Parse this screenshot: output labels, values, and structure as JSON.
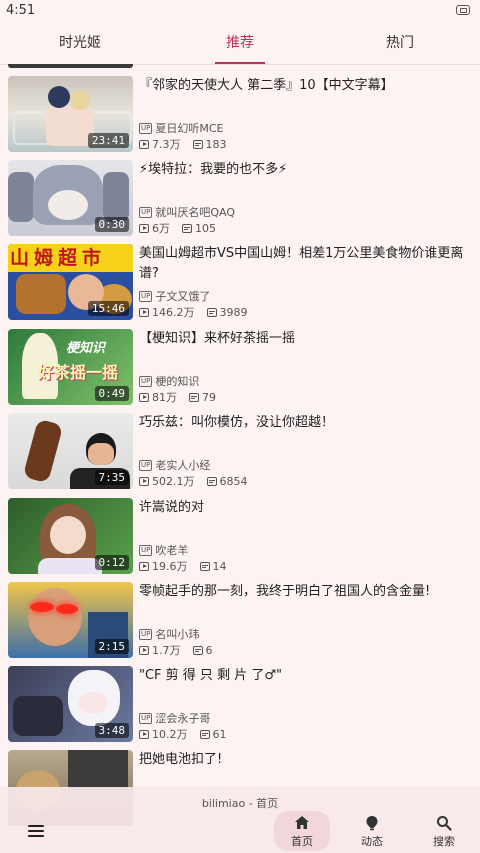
{
  "status_bar": {
    "time": "4:51"
  },
  "tabs": [
    {
      "label": "时光姬"
    },
    {
      "label": "推荐"
    },
    {
      "label": "热门"
    }
  ],
  "active_tab": "推荐",
  "accent_color": "#c0305e",
  "up_badge": "UP",
  "videos": [
    {
      "title": "『邻家的天使大人 第二季』10【中文字幕】",
      "author": "夏日幻听MCE",
      "views": "7.3万",
      "danmaku": "183",
      "duration": "23:41"
    },
    {
      "title": "⚡埃特拉：我要的也不多⚡",
      "author": "就叫厌名吧QAQ",
      "views": "6万",
      "danmaku": "105",
      "duration": "0:30"
    },
    {
      "title": "美国山姆超市VS中国山姆！相差1万公里美食物价谁更离谱?",
      "author": "子文又饿了",
      "views": "146.2万",
      "danmaku": "3989",
      "duration": "15:46",
      "thumb_text": "山姆超市"
    },
    {
      "title": "【梗知识】来杯好茶摇一摇",
      "author": "梗的知识",
      "views": "81万",
      "danmaku": "79",
      "duration": "0:49",
      "thumb_text_1": "梗知识",
      "thumb_text_2": "好茶摇一摇"
    },
    {
      "title": "巧乐兹：叫你模仿，没让你超越！",
      "author": "老实人小经",
      "views": "502.1万",
      "danmaku": "6854",
      "duration": "7:35"
    },
    {
      "title": "许嵩说的对",
      "author": "吹老羊",
      "views": "19.6万",
      "danmaku": "14",
      "duration": "0:12"
    },
    {
      "title": "零帧起手的那一刻，我终于明白了祖国人的含金量!",
      "author": "名叫小玮",
      "views": "1.7万",
      "danmaku": "6",
      "duration": "2:15"
    },
    {
      "title": "\"CF 剪 得 只 剩 片 了♂\"",
      "author": "涩会永子哥",
      "views": "10.2万",
      "danmaku": "61",
      "duration": "3:48"
    },
    {
      "title": "把她电池扣了!",
      "author": "",
      "views": "",
      "danmaku": "",
      "duration": ""
    }
  ],
  "bottom_bar": {
    "caption": "bilimiao - 首页",
    "nav": [
      {
        "label": "首页",
        "icon": "home-icon"
      },
      {
        "label": "动态",
        "icon": "dynamic-icon"
      },
      {
        "label": "搜索",
        "icon": "search-icon"
      }
    ]
  }
}
